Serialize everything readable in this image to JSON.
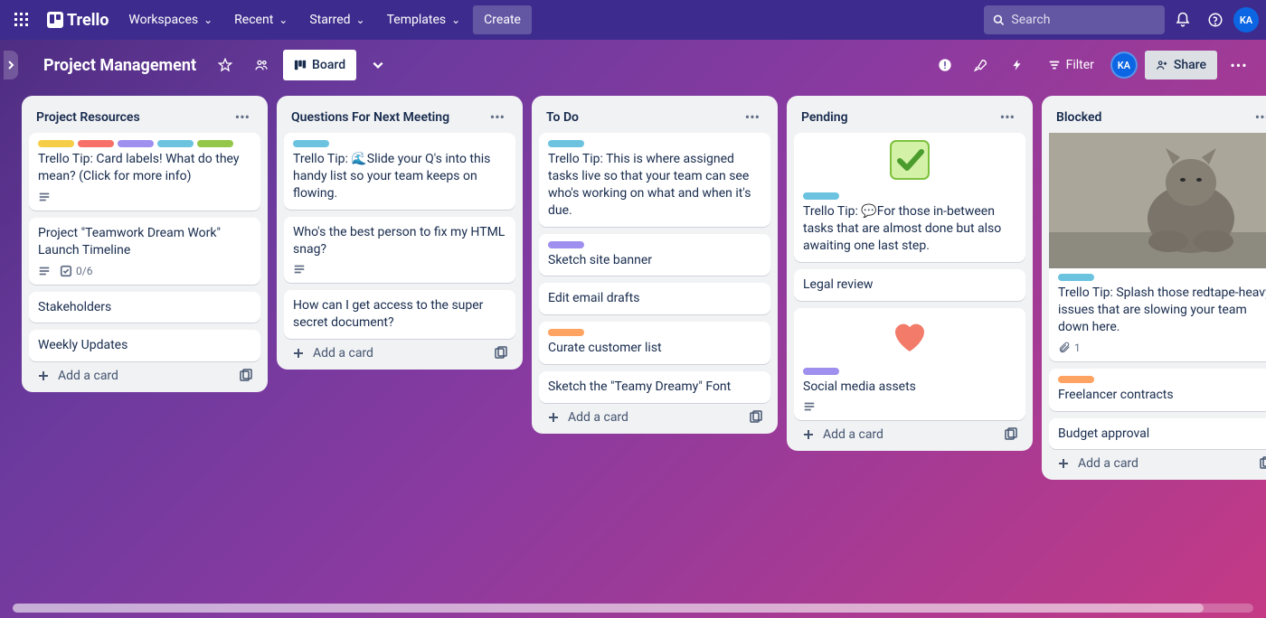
{
  "topnav": {
    "brand": "Trello",
    "items": [
      "Workspaces",
      "Recent",
      "Starred",
      "Templates"
    ],
    "create": "Create",
    "search_placeholder": "Search",
    "avatar_initials": "KA"
  },
  "board_header": {
    "title": "Project Management",
    "view_label": "Board",
    "filter_label": "Filter",
    "share_label": "Share",
    "avatar_initials": "KA"
  },
  "label_colors": {
    "yellow": "#f5cd47",
    "red": "#f87168",
    "purple": "#9f8fef",
    "sky": "#6cc3e0",
    "lime": "#94c748",
    "orange": "#fea362"
  },
  "lists": [
    {
      "title": "Project Resources",
      "cards": [
        {
          "labels": [
            "yellow",
            "red",
            "purple",
            "sky",
            "lime"
          ],
          "title": "Trello Tip: Card labels! What do they mean? (Click for more info)",
          "badges": {
            "desc": true
          }
        },
        {
          "title": "Project \"Teamwork Dream Work\" Launch Timeline",
          "badges": {
            "desc": true,
            "checklist": "0/6"
          }
        },
        {
          "title": "Stakeholders"
        },
        {
          "title": "Weekly Updates"
        }
      ]
    },
    {
      "title": "Questions For Next Meeting",
      "cards": [
        {
          "labels": [
            "sky"
          ],
          "title": "Trello Tip: 🌊Slide your Q's into this handy list so your team keeps on flowing."
        },
        {
          "title": "Who's the best person to fix my HTML snag?",
          "badges": {
            "desc": true
          }
        },
        {
          "title": "How can I get access to the super secret document?"
        }
      ]
    },
    {
      "title": "To Do",
      "cards": [
        {
          "labels": [
            "sky"
          ],
          "title": "Trello Tip: This is where assigned tasks live so that your team can see who's working on what and when it's due."
        },
        {
          "labels": [
            "purple"
          ],
          "title": "Sketch site banner"
        },
        {
          "title": "Edit email drafts"
        },
        {
          "labels": [
            "orange"
          ],
          "title": "Curate customer list"
        },
        {
          "title": "Sketch the \"Teamy Dreamy\" Font"
        }
      ]
    },
    {
      "title": "Pending",
      "cards": [
        {
          "cover": "check",
          "labels": [
            "sky"
          ],
          "title": "Trello Tip: 💬For those in-between tasks that are almost done but also awaiting one last step."
        },
        {
          "title": "Legal review"
        },
        {
          "cover": "heart",
          "labels": [
            "purple"
          ],
          "title": "Social media assets",
          "badges": {
            "desc": true
          }
        }
      ]
    },
    {
      "title": "Blocked",
      "cards": [
        {
          "cover": "cat",
          "labels": [
            "sky"
          ],
          "title": "Trello Tip: Splash those redtape-heavy issues that are slowing your team down here.",
          "badges": {
            "attach": "1"
          }
        },
        {
          "labels": [
            "orange"
          ],
          "title": "Freelancer contracts"
        },
        {
          "title": "Budget approval"
        }
      ]
    }
  ],
  "add_card_label": "Add a card"
}
